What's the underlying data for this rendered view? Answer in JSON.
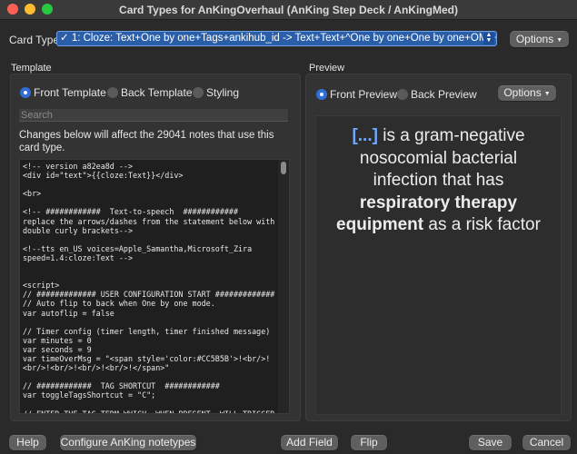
{
  "window": {
    "title": "Card Types for AnKingOverhaul (AnKing Step Deck / AnKingMed)"
  },
  "card_type": {
    "label": "Card Type:",
    "selected": "✓ 1: Cloze: Text+One by one+Tags+ankihub_id -> Text+Text+^One by one+One by one+OME+...",
    "options_button": "Options"
  },
  "template": {
    "section_label": "Template",
    "radios": [
      {
        "label": "Front Template",
        "selected": true
      },
      {
        "label": "Back Template",
        "selected": false
      },
      {
        "label": "Styling",
        "selected": false
      }
    ],
    "search_placeholder": "Search",
    "notice": "Changes below will affect the 29041 notes that use this card type.",
    "code": "<!-- version a82ea8d -->\n<div id=\"text\">{{cloze:Text}}</div>\n\n<br>\n\n<!-- ############  Text-to-speech  ############\nreplace the arrows/dashes from the statement below with\ndouble curly brackets-->\n\n<!--tts en_US voices=Apple_Samantha,Microsoft_Zira\nspeed=1.4:cloze:Text -->\n\n\n<script>\n// ############# USER CONFIGURATION START #############\n// Auto flip to back when One by one mode.\nvar autoflip = false\n\n// Timer config (timer length, timer finished message)\nvar minutes = 0\nvar seconds = 9\nvar timeOverMsg = \"<span style='color:#CC5B5B'>!<br/>!<br/>!<br/>!<br/>!<br/>!</span>\"\n\n// ############  TAG SHORTCUT  ############\nvar toggleTagsShortcut = \"C\";\n\n// ENTER THE TAG TERM WHICH, WHEN PRESENT, WILL TRIGGER A\nRED BACKGROUND\nvar tagID = \"XXXYYYZZZ\""
  },
  "preview": {
    "section_label": "Preview",
    "radios": [
      {
        "label": "Front Preview",
        "selected": true
      },
      {
        "label": "Back Preview",
        "selected": false
      }
    ],
    "options_button": "Options",
    "card": {
      "cloze": "[...]",
      "text1": " is a gram-negative nosocomial bacterial infection that has ",
      "bold": "respiratory therapy equipment",
      "text2": " as a risk factor"
    }
  },
  "footer": {
    "help": "Help",
    "configure": "Configure AnKing notetypes",
    "add_field": "Add Field",
    "flip": "Flip",
    "save": "Save",
    "cancel": "Cancel"
  }
}
